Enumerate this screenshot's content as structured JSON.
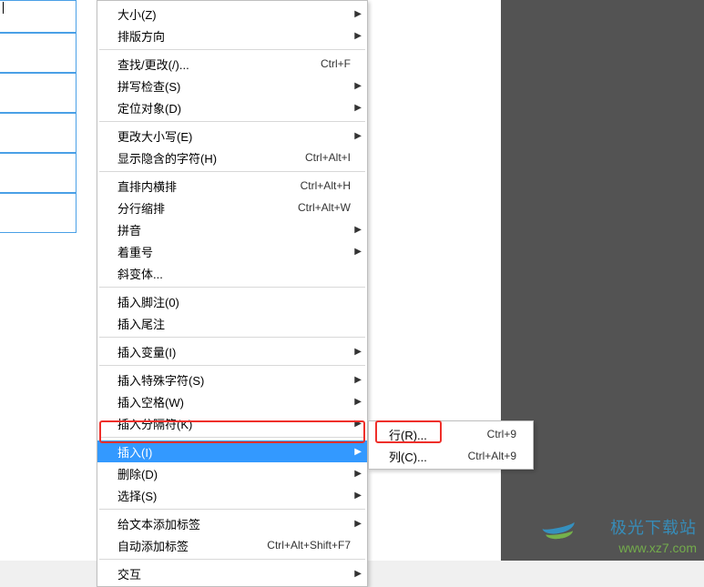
{
  "menu": {
    "items": [
      {
        "label": "大小(Z)",
        "shortcut": "",
        "hasSub": true
      },
      {
        "label": "排版方向",
        "shortcut": "",
        "hasSub": true
      },
      {
        "sep": true
      },
      {
        "label": "查找/更改(/)...",
        "shortcut": "Ctrl+F",
        "hasSub": false
      },
      {
        "label": "拼写检查(S)",
        "shortcut": "",
        "hasSub": true
      },
      {
        "label": "定位对象(D)",
        "shortcut": "",
        "hasSub": true
      },
      {
        "sep": true
      },
      {
        "label": "更改大小写(E)",
        "shortcut": "",
        "hasSub": true
      },
      {
        "label": "显示隐含的字符(H)",
        "shortcut": "Ctrl+Alt+I",
        "hasSub": false
      },
      {
        "sep": true
      },
      {
        "label": "直排内横排",
        "shortcut": "Ctrl+Alt+H",
        "hasSub": false
      },
      {
        "label": "分行缩排",
        "shortcut": "Ctrl+Alt+W",
        "hasSub": false
      },
      {
        "label": "拼音",
        "shortcut": "",
        "hasSub": true
      },
      {
        "label": "着重号",
        "shortcut": "",
        "hasSub": true
      },
      {
        "label": "斜变体...",
        "shortcut": "",
        "hasSub": false
      },
      {
        "sep": true
      },
      {
        "label": "插入脚注(0)",
        "shortcut": "",
        "hasSub": false
      },
      {
        "label": "插入尾注",
        "shortcut": "",
        "hasSub": false
      },
      {
        "sep": true
      },
      {
        "label": "插入变量(I)",
        "shortcut": "",
        "hasSub": true
      },
      {
        "sep": true
      },
      {
        "label": "插入特殊字符(S)",
        "shortcut": "",
        "hasSub": true
      },
      {
        "label": "插入空格(W)",
        "shortcut": "",
        "hasSub": true
      },
      {
        "label": "插入分隔符(K)",
        "shortcut": "",
        "hasSub": true
      },
      {
        "sep": true
      },
      {
        "label": "插入(I)",
        "shortcut": "",
        "hasSub": true,
        "highlight": true
      },
      {
        "label": "删除(D)",
        "shortcut": "",
        "hasSub": true
      },
      {
        "label": "选择(S)",
        "shortcut": "",
        "hasSub": true
      },
      {
        "sep": true
      },
      {
        "label": "给文本添加标签",
        "shortcut": "",
        "hasSub": true
      },
      {
        "label": "自动添加标签",
        "shortcut": "Ctrl+Alt+Shift+F7",
        "hasSub": false
      },
      {
        "sep": true
      },
      {
        "label": "交互",
        "shortcut": "",
        "hasSub": true
      }
    ]
  },
  "submenu": {
    "items": [
      {
        "label": "行(R)...",
        "shortcut": "Ctrl+9"
      },
      {
        "label": "列(C)...",
        "shortcut": "Ctrl+Alt+9"
      }
    ]
  },
  "watermark": {
    "text": "极光下载站",
    "url": "www.xz7.com"
  }
}
